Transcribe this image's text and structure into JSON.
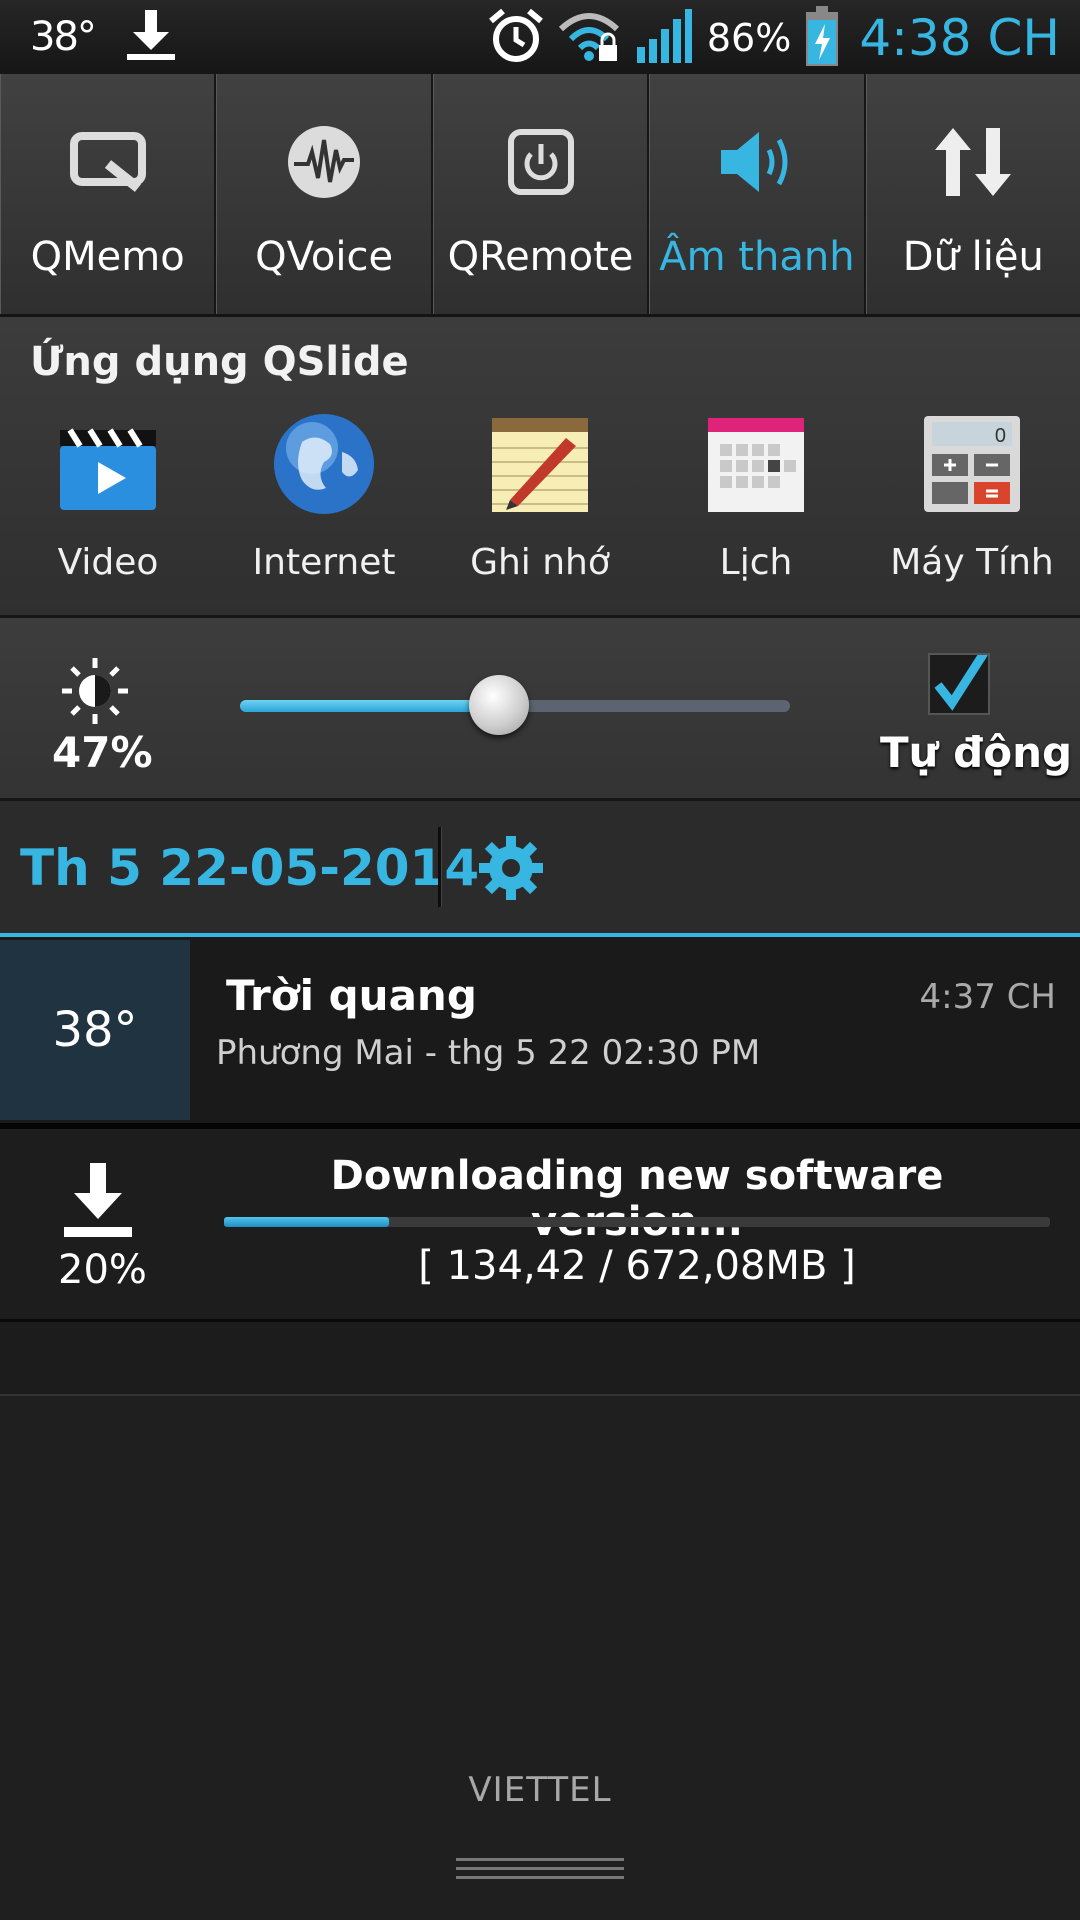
{
  "status_bar": {
    "temperature": "38°",
    "battery_percent": "86%",
    "clock": "4:38 CH",
    "icons": [
      "download-icon",
      "alarm-icon",
      "wifi-locked-icon",
      "signal-icon",
      "battery-charging-icon"
    ]
  },
  "quick_settings": [
    {
      "label": "QMemo",
      "icon": "qmemo-icon",
      "active": false
    },
    {
      "label": "QVoice",
      "icon": "qvoice-icon",
      "active": false
    },
    {
      "label": "QRemote",
      "icon": "qremote-icon",
      "active": false
    },
    {
      "label": "Âm thanh",
      "icon": "speaker-icon",
      "active": true
    },
    {
      "label": "Dữ liệu",
      "icon": "data-arrows-icon",
      "active": false
    }
  ],
  "qslide": {
    "title": "Ứng dụng QSlide",
    "apps": [
      {
        "label": "Video",
        "icon": "video-clapper-icon"
      },
      {
        "label": "Internet",
        "icon": "globe-icon"
      },
      {
        "label": "Ghi nhớ",
        "icon": "notepad-icon"
      },
      {
        "label": "Lịch",
        "icon": "calendar-icon"
      },
      {
        "label": "Máy Tính",
        "icon": "calculator-icon"
      }
    ]
  },
  "brightness": {
    "percent_label": "47%",
    "level": 0.47,
    "auto_label": "Tự động",
    "auto_checked": true
  },
  "date_row": {
    "date": "Th 5 22-05-2014"
  },
  "weather": {
    "temp": "38°",
    "title": "Trời quang",
    "subtitle": "Phương Mai - thg 5 22  02:30 PM",
    "time": "4:37 CH"
  },
  "download": {
    "title": "Downloading new software version...",
    "percent_label": "20%",
    "progress": 0.2,
    "size": "[ 134,42 / 672,08MB ]"
  },
  "carrier": "VIETTEL",
  "colors": {
    "accent": "#37b6e2",
    "background": "#1f1f1f"
  }
}
